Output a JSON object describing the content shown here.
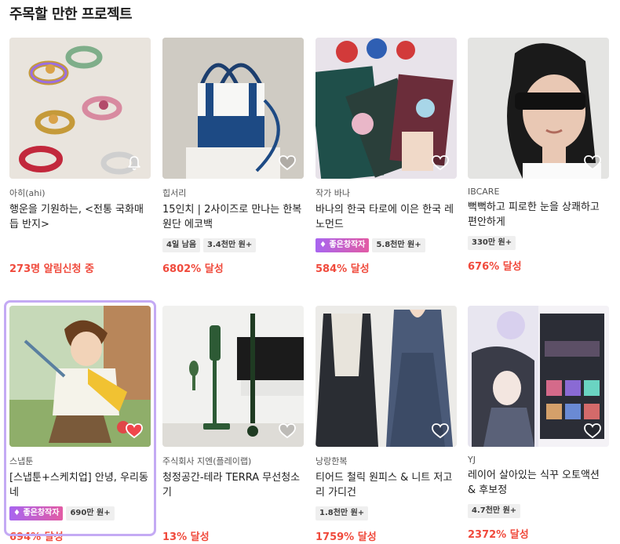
{
  "section": {
    "title": "주목할 만한 프로젝트"
  },
  "projects": [
    {
      "creator": "아히(ahi)",
      "title": "행운을 기원하는, <전통 국화매듭 반지>",
      "tags": [],
      "status": "273명 알림신청 중",
      "icon": "bell-icon"
    },
    {
      "creator": "힙서리",
      "title": "15인치 | 2사이즈로 만나는 한복원단 에코백",
      "tags": [
        "4일 남음",
        "3.4천만 원+"
      ],
      "status": "6802% 달성",
      "icon": "heart-icon"
    },
    {
      "creator": "작가 바나",
      "title": "바나의 한국 타로에 이은 한국 레노먼드",
      "tags": [
        "좋은창작자",
        "5.8천만 원+"
      ],
      "status": "584% 달성",
      "icon": "heart-icon"
    },
    {
      "creator": "IBCARE",
      "title": "뻑뻑하고 피로한 눈을 상쾌하고 편안하게",
      "tags": [
        "330만 원+"
      ],
      "status": "676% 달성",
      "icon": "heart-icon"
    },
    {
      "creator": "스냅툰",
      "title": "[스냅툰+스케치업] 안녕, 우리동네",
      "tags": [
        "좋은창작자",
        "690만 원+"
      ],
      "status": "694% 달성",
      "icon": "heart-filled-icon"
    },
    {
      "creator": "주식회사 지엔(플레이랩)",
      "title": "청정공간-테라 TERRA 무선청소기",
      "tags": [],
      "status": "13% 달성",
      "icon": "heart-icon"
    },
    {
      "creator": "낭랑한복",
      "title": "티어드 철릭 원피스 & 니트 저고리 가디건",
      "tags": [
        "1.8천만 원+"
      ],
      "status": "1759% 달성",
      "icon": "heart-icon"
    },
    {
      "creator": "YJ",
      "title": "레이어 살아있는 식꾸 오토액션 & 후보정",
      "tags": [
        "4.7천만 원+"
      ],
      "status": "2372% 달성",
      "icon": "heart-icon"
    }
  ],
  "colors": {
    "achievement": "#f04a3c",
    "good_creator_gradient": [
      "#a865f0",
      "#e25ba4"
    ],
    "selected_border": "#c4aaf4"
  }
}
